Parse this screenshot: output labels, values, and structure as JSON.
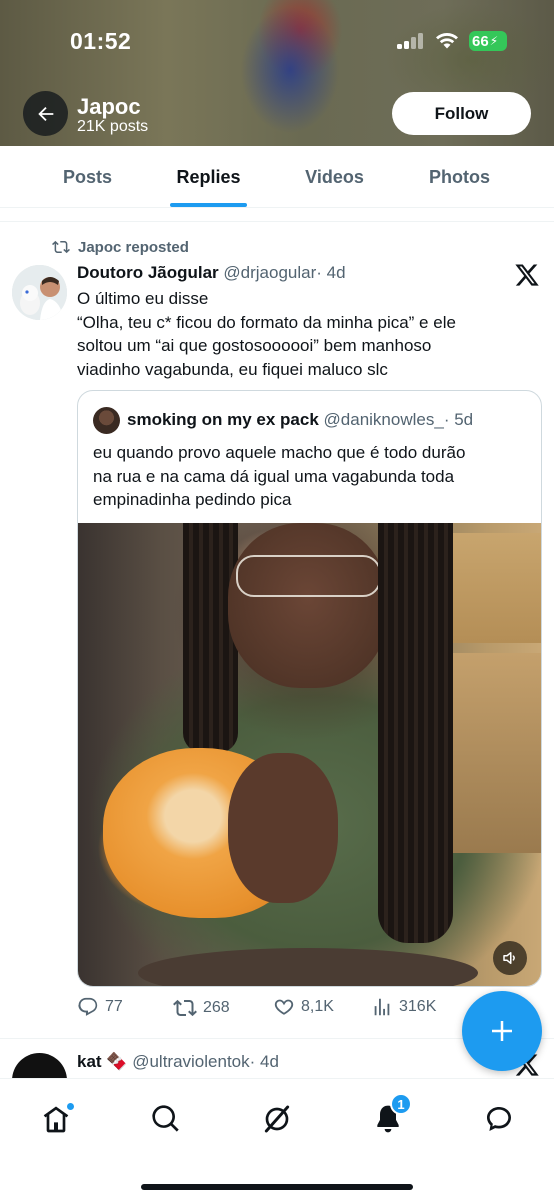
{
  "status_bar": {
    "time": "01:52",
    "battery": "66"
  },
  "profile": {
    "name": "Japoc",
    "posts_count": "21K posts",
    "follow_label": "Follow"
  },
  "tabs": [
    {
      "label": "Posts"
    },
    {
      "label": "Replies"
    },
    {
      "label": "Videos"
    },
    {
      "label": "Photos"
    }
  ],
  "active_tab": "Replies",
  "post": {
    "repost_label": "Japoc reposted",
    "author_name": "Doutoro Jãogular",
    "author_handle": "@drjaogular",
    "time": "· 4d",
    "text_lines": [
      "O último eu disse",
      "“Olha, teu c* ficou do formato da minha pica” e ele",
      "soltou um “ai que gostosoooooi” bem manhoso",
      "viadinho vagabunda, eu fiquei maluco slc"
    ],
    "quote": {
      "author_name": "smoking on my ex pack",
      "author_handle": "@daniknowles_",
      "time": "· 5d",
      "text_lines": [
        "eu quando provo aquele macho que é todo durão",
        "na rua e na cama dá igual uma vagabunda toda",
        "empinadinha pedindo pica"
      ]
    },
    "stats": {
      "replies": "77",
      "reposts": "268",
      "likes": "8,1K",
      "views": "316K"
    }
  },
  "next_post": {
    "author_name": "kat 🍫",
    "author_handle": "@ultraviolentok",
    "time": "· 4d"
  },
  "bottom_nav": {
    "notifications_badge": "1"
  },
  "colors": {
    "accent": "#1d9bf0",
    "text": "#0f1419",
    "muted": "#536471"
  }
}
